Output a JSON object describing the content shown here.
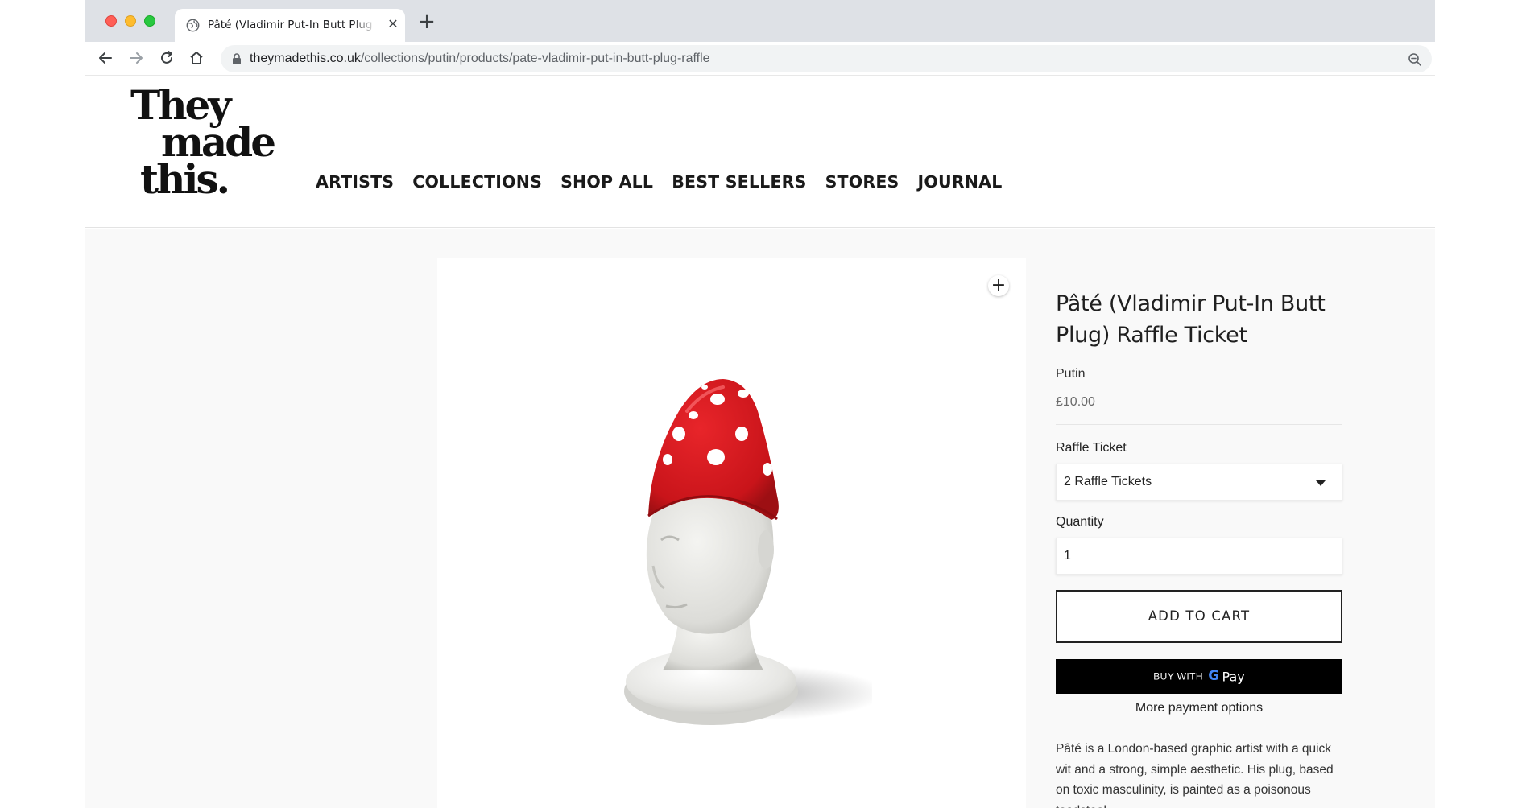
{
  "browser": {
    "tab_title": "Pâté (Vladimir Put-In Butt Plug",
    "url_host": "theymadethis.co.uk",
    "url_path": "/collections/putin/products/pate-vladimir-put-in-butt-plug-raffle"
  },
  "site": {
    "logo_lines": [
      "They",
      "made",
      "this."
    ],
    "nav": [
      "ARTISTS",
      "COLLECTIONS",
      "SHOP ALL",
      "BEST SELLERS",
      "STORES",
      "JOURNAL"
    ]
  },
  "product": {
    "title": "Pâté (Vladimir Put-In Butt Plug) Raffle Ticket",
    "vendor": "Putin",
    "price": "£10.00",
    "option_label": "Raffle Ticket",
    "option_value": "2 Raffle Tickets",
    "quantity_label": "Quantity",
    "quantity_value": "1",
    "add_to_cart": "ADD TO CART",
    "gpay_prefix": "BUY WITH",
    "gpay_g": "G",
    "gpay_pay": "Pay",
    "more_payment": "More payment options",
    "description": "Pâté is a London-based graphic artist with a quick wit and a strong, simple aesthetic. His plug, based on toxic masculinity, is painted as a poisonous toadstool."
  },
  "icons": {
    "favicon": "globe-icon",
    "tab_close": "close-icon",
    "new_tab": "plus-icon",
    "back": "arrow-left-icon",
    "forward": "arrow-right-icon",
    "reload": "reload-icon",
    "home": "home-icon",
    "lock": "lock-icon",
    "zoom": "zoom-icon",
    "image_zoom": "plus-icon"
  },
  "colors": {
    "cap_red": "#d4161b",
    "traffic_red": "#ff5f57",
    "traffic_yellow": "#febc2e",
    "traffic_green": "#28c840"
  }
}
